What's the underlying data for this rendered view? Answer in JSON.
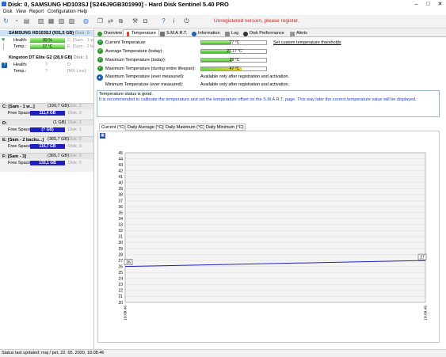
{
  "window": {
    "title": "Disk: 0, SAMSUNG HD103SJ [S246J9GB301990]  -  Hard Disk Sentinel 5.40 PRO",
    "min": "–",
    "max": "□",
    "close": "✕"
  },
  "menu": [
    "Disk",
    "View",
    "Report",
    "Configuration",
    "Help"
  ],
  "unregistered": "Unregistered version, please register.",
  "disks": [
    {
      "name": "SAMSUNG HD103SJ (931,5 GB)",
      "suffix": "Disk: 0",
      "health_label": "Health:",
      "health": "89 %",
      "health_pct": 89,
      "health_right": "C: [Sam - 1 w...",
      "temp_label": "Temp.:",
      "temp": "27 °C",
      "temp_right": "E: [Sam - 2 ba..."
    },
    {
      "name": "Kingston DT Elite G2 (28,9 GB)",
      "suffix": "Disk: 1",
      "health_label": "Health:",
      "health": "?",
      "health_right": "D:",
      "temp_label": "Temp.:",
      "temp": "?",
      "temp_right": "[MX-Live]"
    }
  ],
  "volumes": [
    {
      "name": "C: [Sam - 1 w...]",
      "size": "(199,7 GB)",
      "disk": "Disk: 0",
      "free_label": "Free Space",
      "free": "111,4 GB"
    },
    {
      "name": "D:",
      "size": "(1 GB)",
      "disk": "Disk: 1",
      "free_label": "Free Space",
      "free": "(? GB)"
    },
    {
      "name": "E: [Sam - 2 backu...]",
      "size": "(365,7 GB)",
      "disk": "Disk: 0",
      "free_label": "Free Space",
      "free": "116,7 GB"
    },
    {
      "name": "F: [Sam - 3]",
      "size": "(365,7 GB)",
      "disk": "Disk: 0",
      "free_label": "Free Space",
      "free": "133,1 GB"
    }
  ],
  "tabs": [
    "Overview",
    "Temperature",
    "S.M.A.R.T.",
    "Information",
    "Log",
    "Disk Performance",
    "Alerts"
  ],
  "temperature": {
    "rows": [
      {
        "label": "Current Temperature",
        "value": "27 °C",
        "fill": 0.45
      },
      {
        "label": "Average Temperature (today):",
        "value": "27,17 °C",
        "fill": 0.45
      },
      {
        "label": "Maximum Temperature (today):",
        "value": "29 °C",
        "fill": 0.48
      },
      {
        "label": "Maximum Temperature (during entire lifespan):",
        "value": "47 °C",
        "fill": 0.62
      }
    ],
    "reg_rows": [
      {
        "label": "Maximum Temperature (ever measured):",
        "value": "Available only after registration and activation."
      },
      {
        "label": "Minimum Temperature (ever measured):",
        "value": "Available only after registration and activation."
      }
    ],
    "set_link": "Set custom temperature thresholds",
    "status_title": "Temperature status is good.",
    "status_text": "It is recommended to calibrate the temperature and set the temperature offset on the S.M.A.R.T. page. This way later the correct temperature value will be displayed."
  },
  "subtabs": [
    "Current (°C)",
    "Daily Average (°C)",
    "Daily Maximum (°C)",
    "Daily Minimum (°C)"
  ],
  "chart_data": {
    "type": "line",
    "x": [
      "18:08:46",
      "18:08:46"
    ],
    "series": [
      {
        "values": [
          26,
          27
        ]
      }
    ],
    "start_label": "26",
    "end_label": "27",
    "ylim": [
      20,
      45
    ],
    "yticks": [
      20,
      21,
      22,
      23,
      24,
      25,
      26,
      27,
      28,
      29,
      30,
      31,
      32,
      33,
      34,
      35,
      36,
      37,
      38,
      39,
      40,
      41,
      42,
      43,
      44,
      45
    ],
    "grid": true,
    "line_color": "#1f1fd0"
  },
  "statusbar": "Status last updated: maj / pet, 22. 05. 2020, 18.08.46"
}
